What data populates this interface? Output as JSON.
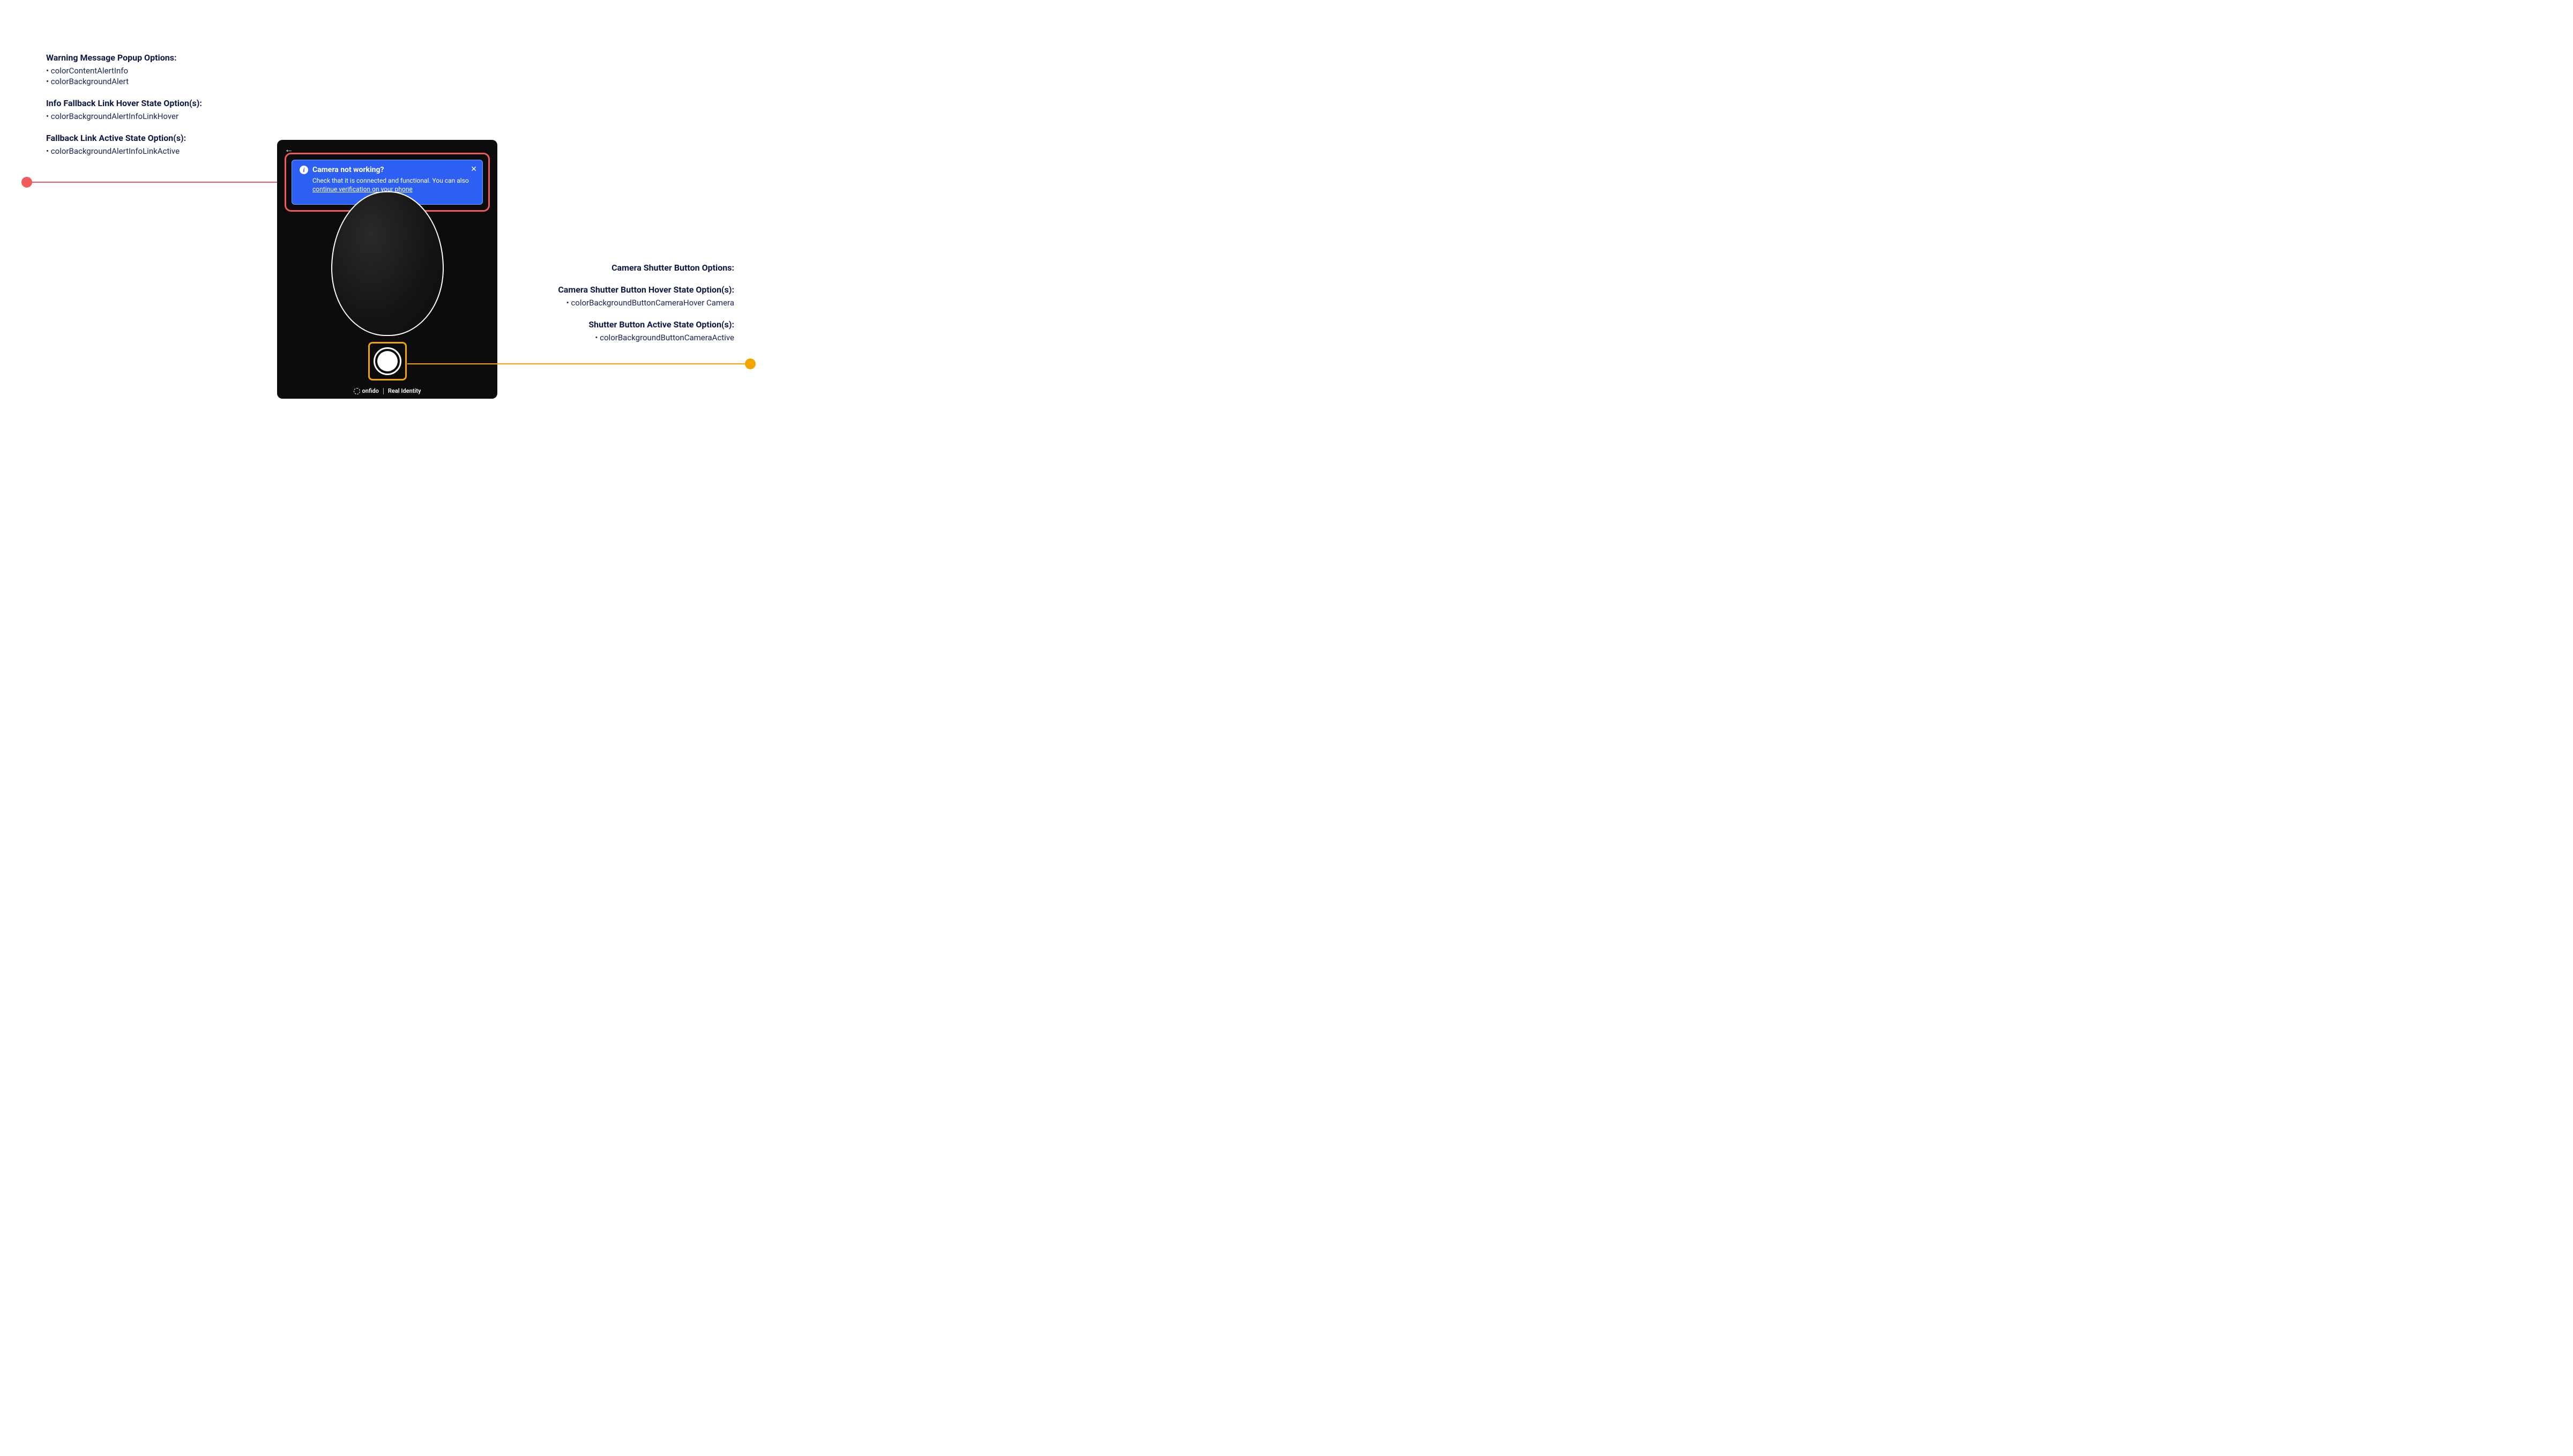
{
  "colors": {
    "text": "#0e1845",
    "highlight_red": "#ef5b5b",
    "highlight_orange": "#f0a500",
    "alert_bg": "#2d5ff3"
  },
  "left_annotations": {
    "warning_popup": {
      "heading": "Warning Message Popup Options:",
      "items": [
        "colorContentAlertInfo",
        "colorBackgroundAlert"
      ]
    },
    "hover_state": {
      "heading": "Info Fallback Link Hover State Option(s):",
      "items": [
        "colorBackgroundAlertInfoLinkHover"
      ]
    },
    "active_state": {
      "heading": "Fallback Link Active State Option(s):",
      "items": [
        "colorBackgroundAlertInfoLinkActive"
      ]
    }
  },
  "right_annotations": {
    "shutter": {
      "heading": "Camera Shutter Button Options:"
    },
    "shutter_hover": {
      "heading": "Camera Shutter Button Hover State Option(s):",
      "items": [
        "colorBackgroundButtonCameraHover Camera"
      ]
    },
    "shutter_active": {
      "heading": "Shutter Button Active State Option(s):",
      "items": [
        "colorBackgroundButtonCameraActive"
      ]
    }
  },
  "mock": {
    "alert": {
      "title": "Camera not working?",
      "body_before_link": "Check that it is connected and functional. You can also ",
      "link_text": "continue verification on your phone"
    },
    "brand": {
      "name": "onfido",
      "sub": "Real Identity"
    }
  },
  "bullet": "• "
}
